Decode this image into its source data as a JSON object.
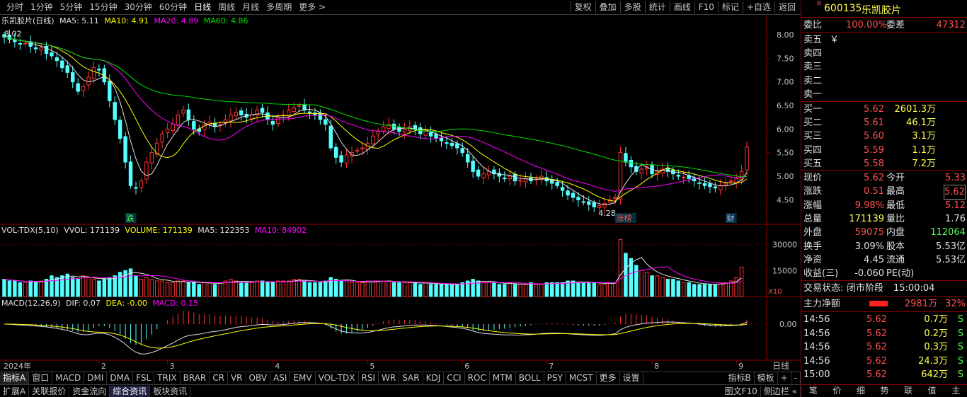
{
  "toolbar": {
    "periods": [
      "分时",
      "1分钟",
      "5分钟",
      "15分钟",
      "30分钟",
      "60分钟",
      "日线",
      "周线",
      "月线",
      "多周期",
      "更多 >"
    ],
    "active_period": "日线",
    "right_buttons": [
      "复权",
      "叠加",
      "多股",
      "统计",
      "画线",
      "F10",
      "标记",
      "+自选",
      "返回"
    ]
  },
  "main_legend": {
    "name": "乐凯胶片(日线)",
    "ma5": "MA5: 5.11",
    "ma10": "MA10: 4.91",
    "ma20": "MA20: 4.89",
    "ma60": "MA60: 4.86"
  },
  "vol_legend": {
    "name": "VOL-TDX(5,10)",
    "vvol": "VVOL: 171139",
    "volume": "VOLUME: 171139",
    "ma5": "MA5: 122353",
    "ma10": "MA10: 84902"
  },
  "macd_legend": {
    "name": "MACD(12,26,9)",
    "dif": "DIF: 0.07",
    "dea": "DEA: -0.00",
    "macd": "MACD: 0.15"
  },
  "annotations": {
    "high_label": "8.02",
    "low_label": "4.28",
    "tag1": "跌",
    "tag2": "涨榜",
    "tag3": "财",
    "vol_scale": "X10"
  },
  "price_axis": [
    "8.00",
    "7.50",
    "7.00",
    "6.50",
    "6.00",
    "5.50",
    "5.00",
    "4.50"
  ],
  "vol_axis": [
    "30000",
    "15000"
  ],
  "macd_axis": [
    "0.00"
  ],
  "date_axis": [
    "2024年",
    "2",
    "3",
    "4",
    "5",
    "6",
    "7",
    "8",
    "9"
  ],
  "period_label": "日线",
  "colors": {
    "up": "#ff3232",
    "down": "#54ffff",
    "ma5": "#e0e0e0",
    "ma10": "#ffff00",
    "ma20": "#ff00ff",
    "ma60": "#00e000"
  },
  "indicator_tabs": [
    "指标A",
    "窗口",
    "MACD",
    "DMI",
    "DMA",
    "FSL",
    "TRIX",
    "BRAR",
    "CR",
    "VR",
    "OBV",
    "ASI",
    "EMV",
    "VOL-TDX",
    "RSI",
    "WR",
    "SAR",
    "KDJ",
    "CCI",
    "ROC",
    "MTM",
    "BOLL",
    "PSY",
    "MCST",
    "更多",
    "设置"
  ],
  "indicator_tabs_right": [
    "指标B",
    "模板",
    "+",
    "-"
  ],
  "status_tabs": [
    "扩展A",
    "关联报价",
    "资金流向",
    "综合资讯",
    "板块资讯"
  ],
  "status_right": [
    "图文F10",
    "侧边栏 «"
  ],
  "quote": {
    "code": "600135",
    "name": "乐凯胶片",
    "r_tag": "R",
    "weibi_label": "委比",
    "weibi": "100.00%",
    "weicha_label": "委差",
    "weicha": "47312",
    "sell": [
      {
        "label": "卖五",
        "price": "￥",
        "vol": ""
      },
      {
        "label": "卖四",
        "price": "",
        "vol": ""
      },
      {
        "label": "卖三",
        "price": "",
        "vol": ""
      },
      {
        "label": "卖二",
        "price": "",
        "vol": ""
      },
      {
        "label": "卖一",
        "price": "",
        "vol": ""
      }
    ],
    "buy": [
      {
        "label": "买一",
        "price": "5.62",
        "vol": "2601.3万"
      },
      {
        "label": "买二",
        "price": "5.61",
        "vol": "46.1万"
      },
      {
        "label": "买三",
        "price": "5.60",
        "vol": "3.1万"
      },
      {
        "label": "买四",
        "price": "5.59",
        "vol": "1.1万"
      },
      {
        "label": "买五",
        "price": "5.58",
        "vol": "7.2万"
      }
    ],
    "stats": [
      {
        "l1": "现价",
        "v1": "5.62",
        "l2": "今开",
        "v2": "5.33"
      },
      {
        "l1": "涨跌",
        "v1": "0.51",
        "l2": "最高",
        "v2": "5.62"
      },
      {
        "l1": "涨幅",
        "v1": "9.98%",
        "l2": "最低",
        "v2": "5.12"
      },
      {
        "l1": "总量",
        "v1": "171139",
        "l2": "量比",
        "v2": "1.76"
      },
      {
        "l1": "外盘",
        "v1": "59075",
        "l2": "内盘",
        "v2": "112064"
      },
      {
        "l1": "换手",
        "v1": "3.09%",
        "l2": "股本",
        "v2": "5.53亿"
      },
      {
        "l1": "净资",
        "v1": "4.45",
        "l2": "流通",
        "v2": "5.53亿"
      },
      {
        "l1": "收益(三)",
        "v1": "-0.060",
        "l2": "PE(动)",
        "v2": ""
      }
    ],
    "trade_status_label": "交易状态:",
    "trade_status": "闭市阶段",
    "trade_time": "15:00:04",
    "main_flow_label": "主力净额",
    "main_flow": "2981万",
    "main_flow_pct": "32%",
    "ticks": [
      {
        "t": "14:56",
        "p": "5.62",
        "v": "0.7万",
        "s": "S"
      },
      {
        "t": "14:56",
        "p": "5.62",
        "v": "0.2万",
        "s": "S"
      },
      {
        "t": "14:56",
        "p": "5.62",
        "v": "0.3万",
        "s": "S"
      },
      {
        "t": "14:56",
        "p": "5.62",
        "v": "24.3万",
        "s": "S"
      },
      {
        "t": "15:00",
        "p": "5.62",
        "v": "642万",
        "s": "S"
      }
    ],
    "bottom_tabs": [
      "笔",
      "价",
      "细",
      "势",
      "联",
      "值",
      "主"
    ]
  },
  "chart_data": {
    "type": "candlestick",
    "title": "乐凯胶片(日线)",
    "ylim": [
      4.1,
      8.3
    ],
    "note_high": 8.02,
    "note_low": 4.28,
    "close_series": [
      7.95,
      7.9,
      7.85,
      7.8,
      7.82,
      7.75,
      7.7,
      7.72,
      7.6,
      7.55,
      7.45,
      7.3,
      7.2,
      7.0,
      6.8,
      6.9,
      7.1,
      7.3,
      7.25,
      7.0,
      6.6,
      6.2,
      5.8,
      5.3,
      4.8,
      4.75,
      4.9,
      5.3,
      5.5,
      5.7,
      5.9,
      6.0,
      6.1,
      6.3,
      6.4,
      6.2,
      6.0,
      5.95,
      6.1,
      6.15,
      6.05,
      6.1,
      6.2,
      6.3,
      6.35,
      6.3,
      6.25,
      6.3,
      6.4,
      6.35,
      6.2,
      6.1,
      6.25,
      6.3,
      6.4,
      6.45,
      6.5,
      6.4,
      6.35,
      6.3,
      6.2,
      6.1,
      5.6,
      5.4,
      5.3,
      5.45,
      5.5,
      5.55,
      5.6,
      5.7,
      5.85,
      5.95,
      6.05,
      6.1,
      6.0,
      5.95,
      6.0,
      6.05,
      6.0,
      5.9,
      5.95,
      5.85,
      5.8,
      5.75,
      5.7,
      5.65,
      5.6,
      5.5,
      5.3,
      5.1,
      5.0,
      5.05,
      5.1,
      5.05,
      5.0,
      4.95,
      5.0,
      4.9,
      4.92,
      4.95,
      4.9,
      4.95,
      5.0,
      4.9,
      4.85,
      4.8,
      4.7,
      4.6,
      4.55,
      4.5,
      4.45,
      4.4,
      4.35,
      4.38,
      4.42,
      4.5,
      4.55,
      5.5,
      5.3,
      5.2,
      5.1,
      5.15,
      5.2,
      5.05,
      5.1,
      5.15,
      5.1,
      5.05,
      5.0,
      4.98,
      4.95,
      4.9,
      4.85,
      4.8,
      4.78,
      4.75,
      4.8,
      4.85,
      4.9,
      4.95,
      5.1,
      5.62
    ],
    "volumes": [
      10,
      9,
      9,
      8,
      8,
      9,
      8,
      9,
      10,
      12,
      11,
      12,
      13,
      11,
      10,
      12,
      11,
      10,
      9,
      10,
      11,
      12,
      14,
      15,
      16,
      12,
      10,
      11,
      10,
      9,
      9,
      8,
      8,
      9,
      9,
      8,
      8,
      7,
      8,
      8,
      7,
      8,
      9,
      10,
      9,
      8,
      8,
      8,
      9,
      9,
      8,
      8,
      9,
      9,
      9,
      10,
      10,
      9,
      8,
      8,
      8,
      9,
      11,
      10,
      9,
      9,
      8,
      8,
      8,
      9,
      9,
      9,
      9,
      9,
      8,
      8,
      8,
      8,
      8,
      7,
      8,
      7,
      7,
      7,
      7,
      7,
      7,
      8,
      9,
      10,
      9,
      8,
      8,
      8,
      7,
      7,
      8,
      7,
      7,
      7,
      8,
      7,
      7,
      8,
      8,
      8,
      8,
      9,
      9,
      8,
      8,
      8,
      8,
      7,
      7,
      8,
      8,
      33,
      25,
      22,
      18,
      15,
      14,
      12,
      12,
      11,
      10,
      10,
      9,
      8,
      8,
      7,
      7,
      7,
      7,
      7,
      8,
      8,
      9,
      11,
      17
    ],
    "ma_values": {
      "MA5": 5.11,
      "MA10": 4.91,
      "MA20": 4.89,
      "MA60": 4.86
    },
    "macd_values": {
      "DIF": 0.07,
      "DEA": -0.0,
      "MACD": 0.15
    }
  }
}
